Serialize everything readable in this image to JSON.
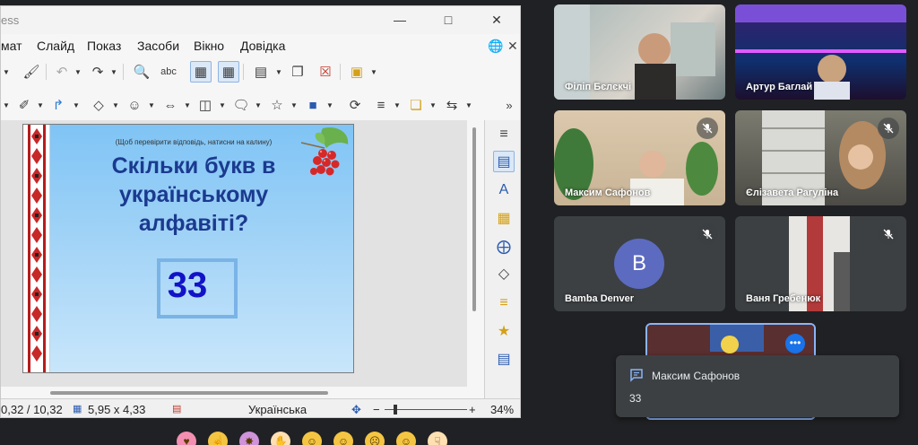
{
  "libreoffice": {
    "title_partial": "ess",
    "menu": [
      "мат",
      "Слайд",
      "Показ",
      "Засоби",
      "Вікно",
      "Довідка"
    ],
    "slide": {
      "hint": "(Щоб перевірити відповідь, натисни на калину)",
      "question": "Скільки букв в українському алфавіті?",
      "answer": "33"
    },
    "status": {
      "position": "0,32 / 10,32",
      "size": "5,95 x 4,33",
      "language": "Українська",
      "zoom": "34%"
    }
  },
  "meet": {
    "participants": [
      {
        "name": "Філіп Бєлєкчі",
        "muted": false
      },
      {
        "name": "Артур Баглай",
        "muted": false
      },
      {
        "name": "Максим Сафонов",
        "muted": true
      },
      {
        "name": "Єлізавета Рагуліна",
        "muted": true
      },
      {
        "name": "Bamba Denver",
        "muted": true,
        "avatar_letter": "B"
      },
      {
        "name": "Ваня Гребенюк",
        "muted": true
      }
    ],
    "chat": {
      "sender": "Максим Сафонов",
      "message": "33"
    }
  },
  "colors": {
    "meet_bg": "#202124",
    "accent_blue": "#8ab4f8",
    "slide_title": "#1b3a8f",
    "answer": "#1212c8"
  }
}
